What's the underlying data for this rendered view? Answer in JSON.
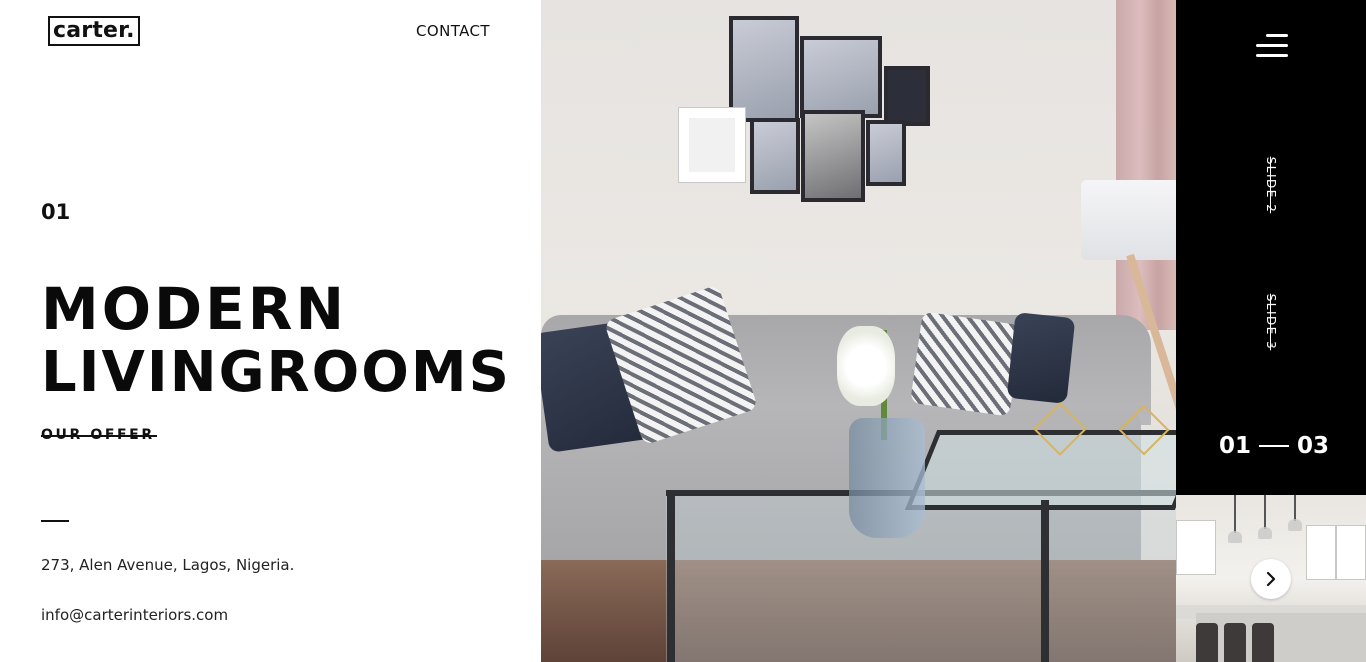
{
  "brand": {
    "logo_text": "carter."
  },
  "nav": {
    "contact_label": "CONTACT"
  },
  "hero": {
    "slide_number": "01",
    "headline_line1": "MODERN",
    "headline_line2": "LIVINGROOMS",
    "cta_label": "OUR OFFER"
  },
  "footer_info": {
    "address": "273, Alen Avenue, Lagos, Nigeria.",
    "email": "info@carterinteriors.com"
  },
  "slider": {
    "links": [
      "SLIDE 2",
      "SLIDE 3"
    ],
    "current": "01",
    "total": "03",
    "next_icon": "chevron-right-icon"
  },
  "menu": {
    "icon": "hamburger-menu-icon"
  },
  "colors": {
    "panel_bg": "#000000",
    "text": "#111111",
    "background": "#ffffff"
  }
}
